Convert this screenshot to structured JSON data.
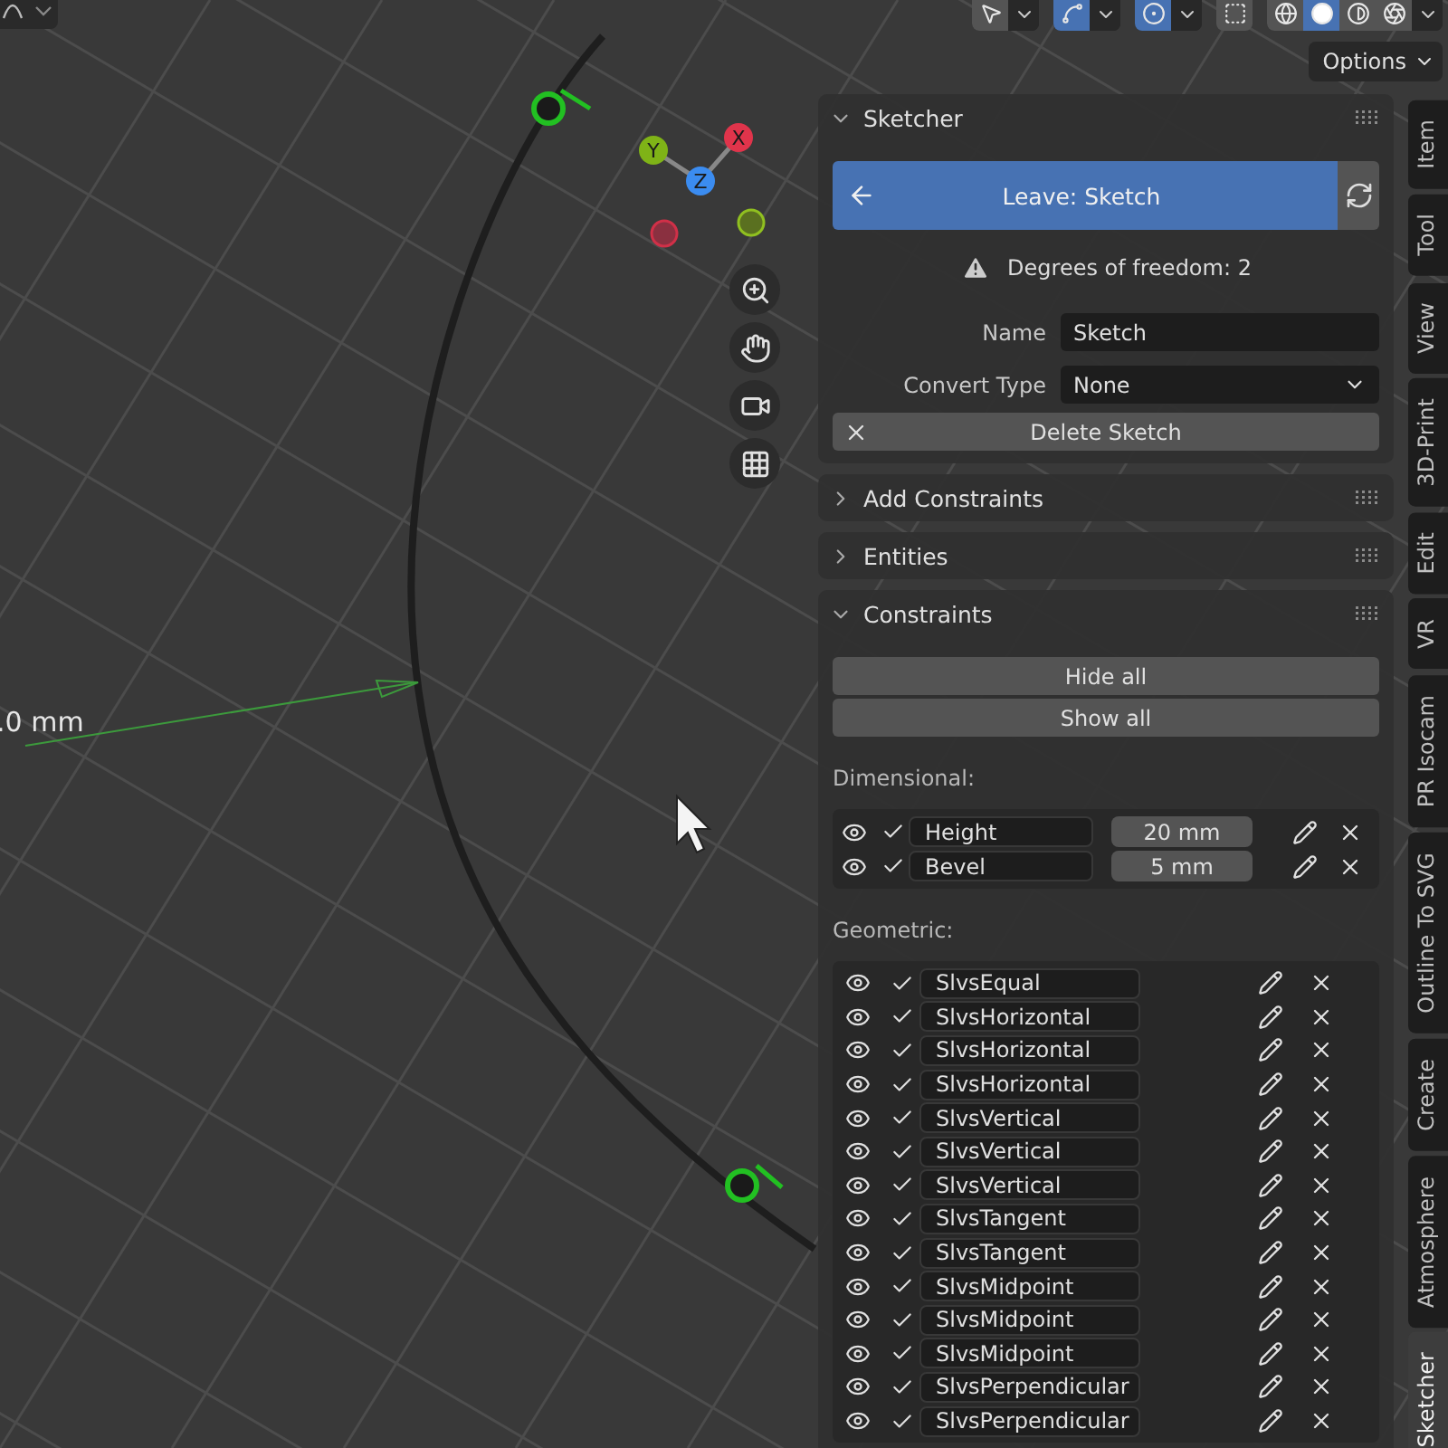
{
  "toolbar": [
    {
      "kind": "select",
      "on": false
    },
    {
      "kind": "gizmo",
      "on": true
    },
    {
      "kind": "overlay",
      "on": true
    },
    {
      "kind": "xray",
      "on": false
    }
  ],
  "shading": [
    {
      "kind": "wireframe",
      "selected": false
    },
    {
      "kind": "solid",
      "selected": true
    },
    {
      "kind": "material",
      "selected": false
    },
    {
      "kind": "rendered",
      "selected": false
    }
  ],
  "options": "Options",
  "viewport": {
    "dimension": ".0 mm",
    "axes": [
      {
        "label": "Y",
        "color": "#7fb317"
      },
      {
        "label": "X",
        "color": "#e0344b"
      },
      {
        "label": "Z",
        "color": "#3b8cf0"
      }
    ]
  },
  "panels": [
    {
      "kind": "sketcher",
      "title": "Sketcher",
      "expanded": true
    },
    {
      "title": "Add Constraints",
      "expanded": false
    },
    {
      "title": "Entities",
      "expanded": false
    },
    {
      "kind": "constraints",
      "title": "Constraints",
      "expanded": true
    }
  ],
  "sketcher": {
    "leave": "Leave: Sketch",
    "warning": "Degrees of freedom: 2",
    "name_label": "Name",
    "name": "Sketch",
    "convert_label": "Convert Type",
    "convert": "None",
    "delete": "Delete Sketch"
  },
  "constraints": {
    "hide_all": "Hide all",
    "show_all": "Show all",
    "dimensional_label": "Dimensional:",
    "dimensional": [
      {
        "name": "Height",
        "value": "20 mm"
      },
      {
        "name": "Bevel",
        "value": "5 mm"
      }
    ],
    "geometric_label": "Geometric:",
    "geometric": [
      "SlvsEqual",
      "SlvsHorizontal",
      "SlvsHorizontal",
      "SlvsHorizontal",
      "SlvsVertical",
      "SlvsVertical",
      "SlvsVertical",
      "SlvsTangent",
      "SlvsTangent",
      "SlvsMidpoint",
      "SlvsMidpoint",
      "SlvsMidpoint",
      "SlvsPerpendicular",
      "SlvsPerpendicular"
    ]
  },
  "tabs": [
    {
      "label": "Item",
      "selected": false
    },
    {
      "label": "Tool",
      "selected": false
    },
    {
      "label": "View",
      "selected": false
    },
    {
      "label": "3D-Print",
      "selected": false
    },
    {
      "label": "Edit",
      "selected": false
    },
    {
      "label": "VR",
      "selected": false
    },
    {
      "label": "PR Isocam",
      "selected": false
    },
    {
      "label": "Outline To SVG",
      "selected": false
    },
    {
      "label": "Create",
      "selected": false
    },
    {
      "label": "Atmosphere",
      "selected": false
    },
    {
      "label": "Sketcher",
      "selected": true
    }
  ]
}
